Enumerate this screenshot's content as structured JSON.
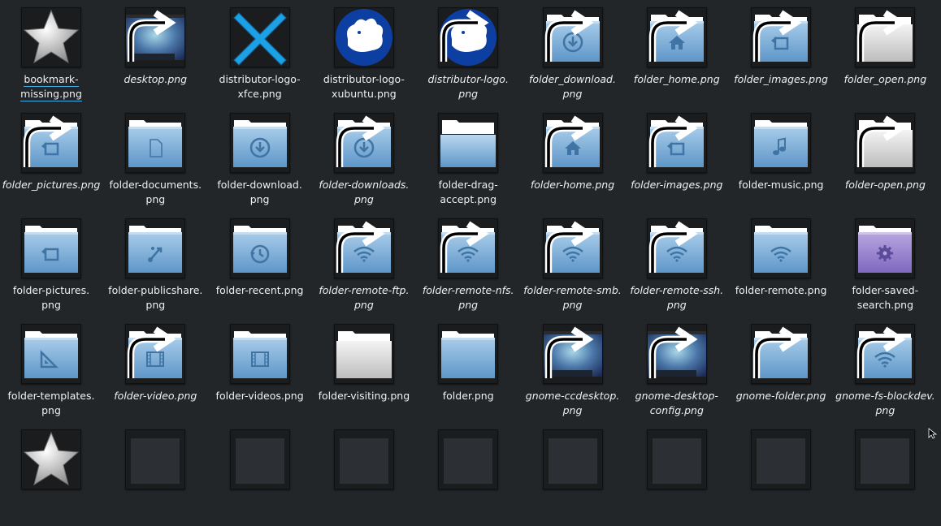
{
  "window": {
    "title": ""
  },
  "icons": [
    {
      "name": "bookmark-missing.png",
      "label": "bookmark-\nmissing.png",
      "kind": "star",
      "link": false,
      "italic": false,
      "focused": true
    },
    {
      "name": "desktop.png",
      "label": "desktop.png",
      "kind": "desktop",
      "link": true,
      "italic": true
    },
    {
      "name": "distributor-logo-xfce.png",
      "label": "distributor-logo-\nxfce.png",
      "kind": "xfce",
      "link": false,
      "italic": false
    },
    {
      "name": "distributor-logo-xubuntu.png",
      "label": "distributor-logo-\nxubuntu.png",
      "kind": "xubuntu",
      "link": false,
      "italic": false
    },
    {
      "name": "distributor-logo.png",
      "label": "distributor-logo.\npng",
      "kind": "xubuntu",
      "link": true,
      "italic": true
    },
    {
      "name": "folder_download.png",
      "label": "folder_download.\npng",
      "kind": "folder",
      "glyph": "download",
      "link": true,
      "italic": true
    },
    {
      "name": "folder_home.png",
      "label": "folder_home.png",
      "kind": "folder",
      "glyph": "home",
      "link": true,
      "italic": true
    },
    {
      "name": "folder_images.png",
      "label": "folder_images.png",
      "kind": "folder",
      "glyph": "images",
      "link": true,
      "italic": true
    },
    {
      "name": "folder_open.png",
      "label": "folder_open.png",
      "kind": "folder-open",
      "link": true,
      "italic": true
    },
    {
      "name": "folder_pictures.png",
      "label": "folder_pictures.png",
      "kind": "folder",
      "glyph": "images",
      "link": true,
      "italic": true
    },
    {
      "name": "folder-documents.png",
      "label": "folder-documents.\npng",
      "kind": "folder",
      "glyph": "document",
      "link": false,
      "italic": false
    },
    {
      "name": "folder-download.png",
      "label": "folder-download.\npng",
      "kind": "folder",
      "glyph": "download",
      "link": false,
      "italic": false
    },
    {
      "name": "folder-downloads.png",
      "label": "folder-downloads.\npng",
      "kind": "folder",
      "glyph": "download",
      "link": true,
      "italic": true
    },
    {
      "name": "folder-drag-accept.png",
      "label": "folder-drag-\naccept.png",
      "kind": "folder-open-blue",
      "link": false,
      "italic": false
    },
    {
      "name": "folder-home.png",
      "label": "folder-home.png",
      "kind": "folder",
      "glyph": "home",
      "link": true,
      "italic": true
    },
    {
      "name": "folder-images.png",
      "label": "folder-images.png",
      "kind": "folder",
      "glyph": "images",
      "link": true,
      "italic": true
    },
    {
      "name": "folder-music.png",
      "label": "folder-music.png",
      "kind": "folder",
      "glyph": "music",
      "link": false,
      "italic": false
    },
    {
      "name": "folder-open.png",
      "label": "folder-open.png",
      "kind": "folder-open",
      "link": true,
      "italic": true
    },
    {
      "name": "folder-pictures.png",
      "label": "folder-pictures.\npng",
      "kind": "folder",
      "glyph": "images",
      "link": false,
      "italic": false
    },
    {
      "name": "folder-publicshare.png",
      "label": "folder-publicshare.\npng",
      "kind": "folder",
      "glyph": "share",
      "link": false,
      "italic": false
    },
    {
      "name": "folder-recent.png",
      "label": "folder-recent.png",
      "kind": "folder",
      "glyph": "recent",
      "link": false,
      "italic": false
    },
    {
      "name": "folder-remote-ftp.png",
      "label": "folder-remote-ftp.\npng",
      "kind": "folder",
      "glyph": "wifi",
      "link": true,
      "italic": true
    },
    {
      "name": "folder-remote-nfs.png",
      "label": "folder-remote-nfs.\npng",
      "kind": "folder",
      "glyph": "wifi",
      "link": true,
      "italic": true
    },
    {
      "name": "folder-remote-smb.png",
      "label": "folder-remote-smb.\npng",
      "kind": "folder",
      "glyph": "wifi",
      "link": true,
      "italic": true
    },
    {
      "name": "folder-remote-ssh.png",
      "label": "folder-remote-ssh.\npng",
      "kind": "folder",
      "glyph": "wifi",
      "link": true,
      "italic": true
    },
    {
      "name": "folder-remote.png",
      "label": "folder-remote.png",
      "kind": "folder",
      "glyph": "wifi",
      "link": false,
      "italic": false
    },
    {
      "name": "folder-saved-search.png",
      "label": "folder-saved-\nsearch.png",
      "kind": "folder-purple",
      "glyph": "gear",
      "link": false,
      "italic": false
    },
    {
      "name": "folder-templates.png",
      "label": "folder-templates.\npng",
      "kind": "folder",
      "glyph": "templates",
      "link": false,
      "italic": false
    },
    {
      "name": "folder-video.png",
      "label": "folder-video.png",
      "kind": "folder",
      "glyph": "video",
      "link": true,
      "italic": true
    },
    {
      "name": "folder-videos.png",
      "label": "folder-videos.png",
      "kind": "folder",
      "glyph": "video",
      "link": false,
      "italic": false
    },
    {
      "name": "folder-visiting.png",
      "label": "folder-visiting.png",
      "kind": "folder-open",
      "link": false,
      "italic": false
    },
    {
      "name": "folder.png",
      "label": "folder.png",
      "kind": "folder-plain",
      "link": false,
      "italic": false
    },
    {
      "name": "gnome-ccdesktop.png",
      "label": "gnome-ccdesktop.\npng",
      "kind": "desktop",
      "link": true,
      "italic": true
    },
    {
      "name": "gnome-desktop-config.png",
      "label": "gnome-desktop-\nconfig.png",
      "kind": "desktop",
      "link": true,
      "italic": true
    },
    {
      "name": "gnome-folder.png",
      "label": "gnome-folder.png",
      "kind": "folder-plain",
      "link": true,
      "italic": true
    },
    {
      "name": "gnome-fs-blockdev.png",
      "label": "gnome-fs-blockdev.\npng",
      "kind": "folder",
      "glyph": "wifi",
      "link": true,
      "italic": true
    },
    {
      "name": "row5-0",
      "label": "",
      "kind": "star",
      "link": false,
      "italic": false
    },
    {
      "name": "row5-1",
      "label": "",
      "kind": "dark",
      "link": false,
      "italic": false
    },
    {
      "name": "row5-2",
      "label": "",
      "kind": "dark",
      "link": false,
      "italic": false
    },
    {
      "name": "row5-3",
      "label": "",
      "kind": "dark",
      "link": false,
      "italic": false
    },
    {
      "name": "row5-4",
      "label": "",
      "kind": "dark",
      "link": false,
      "italic": false
    },
    {
      "name": "row5-5",
      "label": "",
      "kind": "dark",
      "link": false,
      "italic": false
    },
    {
      "name": "row5-6",
      "label": "",
      "kind": "dark",
      "link": false,
      "italic": false
    },
    {
      "name": "row5-7",
      "label": "",
      "kind": "dark",
      "link": false,
      "italic": false
    },
    {
      "name": "row5-8",
      "label": "",
      "kind": "dark",
      "link": false,
      "italic": false
    }
  ],
  "colors": {
    "background": "#232629",
    "text": "#eff0f1",
    "focus": "#3daee9",
    "folder_top": "#a9cdea",
    "folder_bottom": "#5e96c8",
    "glyph": "#3f74a4"
  }
}
